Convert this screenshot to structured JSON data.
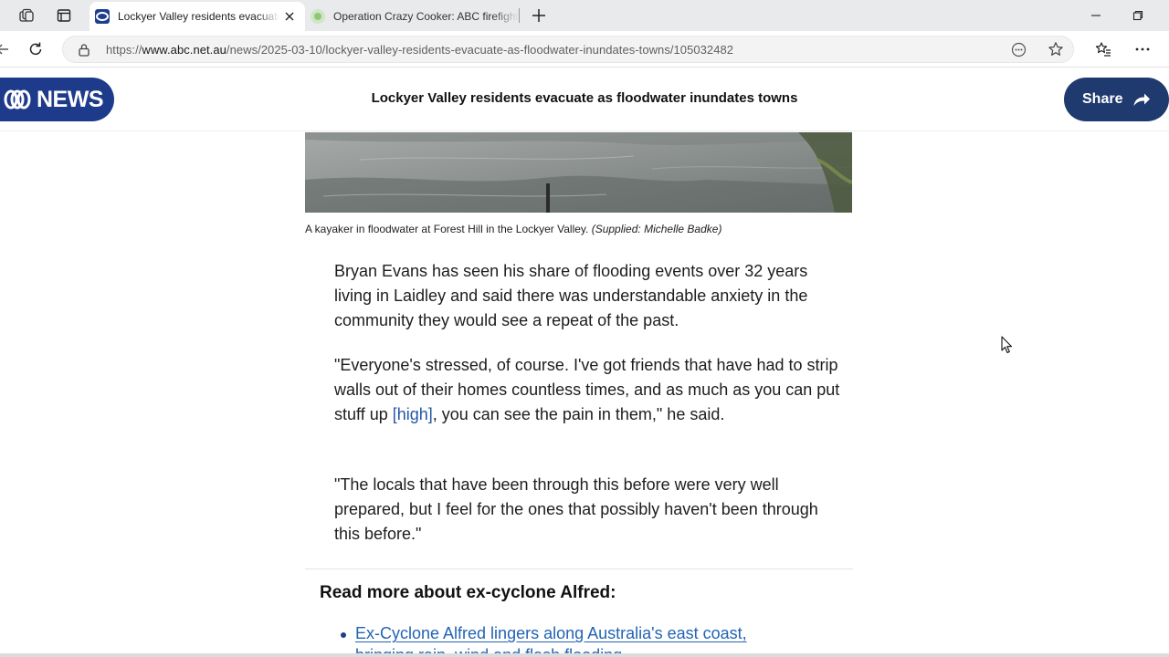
{
  "browser": {
    "tabs": [
      {
        "title": "Lockyer Valley residents evacuate as floodwater inundates towns",
        "active": true,
        "favicon": "abc-icon"
      },
      {
        "title": "Operation Crazy Cooker: ABC firefighting report",
        "active": false,
        "favicon": "loading-icon"
      }
    ],
    "address": {
      "scheme": "https://",
      "host": "www.abc.net.au",
      "path": "/news/2025-03-10/lockyer-valley-residents-evacuate-as-floodwater-inundates-towns/105032482"
    }
  },
  "header": {
    "logo_text": "NEWS",
    "title": "Lockyer Valley residents evacuate as floodwater inundates towns",
    "share_label": "Share"
  },
  "article": {
    "caption_text": "A kayaker in floodwater at Forest Hill in the Lockyer Valley.",
    "caption_credit": "(Supplied: Michelle Badke)",
    "paragraphs": {
      "p1": "Bryan Evans has seen his share of flooding events over 32 years living in Laidley and said there was understandable anxiety in the community they would see a repeat of the past.",
      "p2_before": "\"Everyone's stressed, of course. I've got friends that have had to strip walls out of their homes countless times, and as much as you can put stuff up ",
      "p2_link": "[high]",
      "p2_after": ", you can see the pain in them,\" he said.",
      "p3": "\"The locals that have been through this before were very well prepared, but I feel for the ones that possibly haven't been through this before.\""
    },
    "read_more_title": "Read more about ex-cyclone Alfred:",
    "read_more_links": [
      "Ex-Cyclone Alfred lingers along Australia's east coast,",
      "bringing rain, wind and flash flooding"
    ]
  },
  "colors": {
    "abc_blue": "#1e3a8a",
    "share_navy": "#1e3a6e",
    "link_blue": "#2264b4"
  }
}
